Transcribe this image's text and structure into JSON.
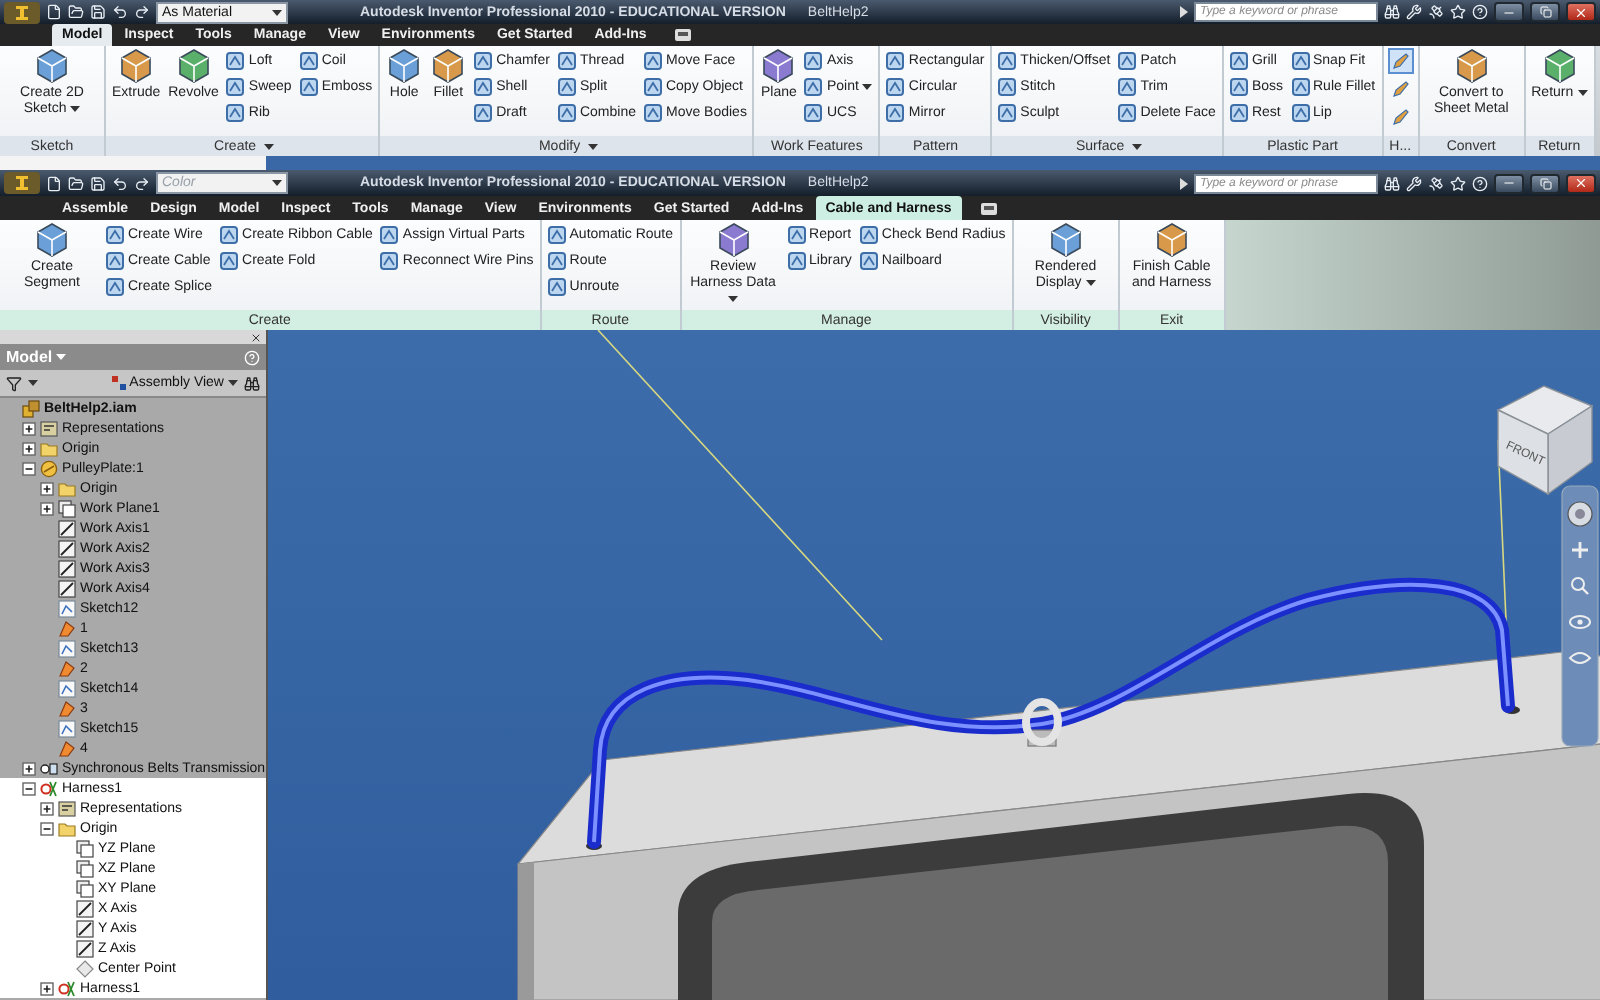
{
  "back_window": {
    "combo": {
      "value": "As Material",
      "disabled": false
    },
    "title": "Autodesk Inventor Professional 2010 - EDUCATIONAL VERSION",
    "document": "BeltHelp2",
    "search": {
      "placeholder": "Type a keyword or phrase"
    },
    "tabs": [
      {
        "label": "Model",
        "selected": true
      },
      {
        "label": "Inspect",
        "selected": false
      },
      {
        "label": "Tools",
        "selected": false
      },
      {
        "label": "Manage",
        "selected": false
      },
      {
        "label": "View",
        "selected": false
      },
      {
        "label": "Environments",
        "selected": false
      },
      {
        "label": "Get Started",
        "selected": false
      },
      {
        "label": "Add-Ins",
        "selected": false
      }
    ],
    "panels": [
      {
        "label": "Sketch",
        "columns": [
          [
            {
              "label": "Create 2D Sketch",
              "kind": "large",
              "menu": true
            }
          ]
        ]
      },
      {
        "label": "Create",
        "menu": true,
        "columns": [
          [
            {
              "label": "Extrude",
              "kind": "large"
            }
          ],
          [
            {
              "label": "Revolve",
              "kind": "large"
            }
          ],
          [
            {
              "label": "Loft",
              "kind": "small"
            },
            {
              "label": "Sweep",
              "kind": "small"
            },
            {
              "label": "Rib",
              "kind": "small"
            }
          ],
          [
            {
              "label": "Coil",
              "kind": "small"
            },
            {
              "label": "Emboss",
              "kind": "small"
            }
          ]
        ]
      },
      {
        "label": "Modify",
        "menu": true,
        "columns": [
          [
            {
              "label": "Hole",
              "kind": "large"
            }
          ],
          [
            {
              "label": "Fillet",
              "kind": "large"
            }
          ],
          [
            {
              "label": "Chamfer",
              "kind": "small"
            },
            {
              "label": "Shell",
              "kind": "small"
            },
            {
              "label": "Draft",
              "kind": "small"
            }
          ],
          [
            {
              "label": "Thread",
              "kind": "small"
            },
            {
              "label": "Split",
              "kind": "small"
            },
            {
              "label": "Combine",
              "kind": "small"
            }
          ],
          [
            {
              "label": "Move Face",
              "kind": "small"
            },
            {
              "label": "Copy Object",
              "kind": "small"
            },
            {
              "label": "Move Bodies",
              "kind": "small"
            }
          ]
        ]
      },
      {
        "label": "Work Features",
        "columns": [
          [
            {
              "label": "Plane",
              "kind": "large"
            }
          ],
          [
            {
              "label": "Axis",
              "kind": "small"
            },
            {
              "label": "Point",
              "kind": "small",
              "menu": true
            },
            {
              "label": "UCS",
              "kind": "small"
            }
          ]
        ]
      },
      {
        "label": "Pattern",
        "columns": [
          [
            {
              "label": "Rectangular",
              "kind": "small"
            },
            {
              "label": "Circular",
              "kind": "small"
            },
            {
              "label": "Mirror",
              "kind": "small"
            }
          ]
        ]
      },
      {
        "label": "Surface",
        "menu": true,
        "columns": [
          [
            {
              "label": "Thicken/Offset",
              "kind": "small"
            },
            {
              "label": "Stitch",
              "kind": "small"
            },
            {
              "label": "Sculpt",
              "kind": "small"
            }
          ],
          [
            {
              "label": "Patch",
              "kind": "small"
            },
            {
              "label": "Trim",
              "kind": "small"
            },
            {
              "label": "Delete Face",
              "kind": "small"
            }
          ]
        ]
      },
      {
        "label": "Plastic Part",
        "columns": [
          [
            {
              "label": "Grill",
              "kind": "small"
            },
            {
              "label": "Boss",
              "kind": "small"
            },
            {
              "label": "Rest",
              "kind": "small"
            }
          ],
          [
            {
              "label": "Snap Fit",
              "kind": "small"
            },
            {
              "label": "Rule Fillet",
              "kind": "small"
            },
            {
              "label": "Lip",
              "kind": "small"
            }
          ]
        ]
      },
      {
        "label": "H...",
        "columns": [
          [
            {
              "kind": "icon",
              "selected": true
            },
            {
              "kind": "icon",
              "selected": false
            },
            {
              "kind": "icon",
              "selected": false
            }
          ]
        ]
      },
      {
        "label": "Convert",
        "columns": [
          [
            {
              "label": "Convert to Sheet Metal",
              "kind": "large"
            }
          ]
        ]
      },
      {
        "label": "Return",
        "columns": [
          [
            {
              "label": "Return",
              "kind": "large",
              "menu": true
            }
          ]
        ]
      }
    ]
  },
  "front_window": {
    "combo": {
      "value": "Color",
      "disabled": true
    },
    "title": "Autodesk Inventor Professional 2010 - EDUCATIONAL VERSION",
    "document": "BeltHelp2",
    "search": {
      "placeholder": "Type a keyword or phrase"
    },
    "tabs": [
      {
        "label": "Assemble",
        "selected": false
      },
      {
        "label": "Design",
        "selected": false
      },
      {
        "label": "Model",
        "selected": false
      },
      {
        "label": "Inspect",
        "selected": false
      },
      {
        "label": "Tools",
        "selected": false
      },
      {
        "label": "Manage",
        "selected": false
      },
      {
        "label": "View",
        "selected": false
      },
      {
        "label": "Environments",
        "selected": false
      },
      {
        "label": "Get Started",
        "selected": false
      },
      {
        "label": "Add-Ins",
        "selected": false
      },
      {
        "label": "Cable and Harness",
        "selected": true
      }
    ],
    "panels": [
      {
        "label": "Create",
        "columns": [
          [
            {
              "label": "Create Segment",
              "kind": "large"
            }
          ],
          [
            {
              "label": "Create Wire",
              "kind": "small"
            },
            {
              "label": "Create Cable",
              "kind": "small"
            },
            {
              "label": "Create Splice",
              "kind": "small"
            }
          ],
          [
            {
              "label": "Create Ribbon Cable",
              "kind": "small"
            },
            {
              "label": "Create Fold",
              "kind": "small"
            }
          ],
          [
            {
              "label": "Assign Virtual Parts",
              "kind": "small"
            },
            {
              "label": "Reconnect Wire Pins",
              "kind": "small"
            }
          ]
        ]
      },
      {
        "label": "Route",
        "columns": [
          [
            {
              "label": "Automatic Route",
              "kind": "small"
            },
            {
              "label": "Route",
              "kind": "small"
            },
            {
              "label": "Unroute",
              "kind": "small"
            }
          ]
        ]
      },
      {
        "label": "Manage",
        "columns": [
          [
            {
              "label": "Review Harness Data",
              "kind": "large",
              "menu": true
            }
          ],
          [
            {
              "label": "Report",
              "kind": "small"
            },
            {
              "label": "Library",
              "kind": "small"
            }
          ],
          [
            {
              "label": "Check Bend Radius",
              "kind": "small"
            },
            {
              "label": "Nailboard",
              "kind": "small"
            }
          ]
        ]
      },
      {
        "label": "Visibility",
        "columns": [
          [
            {
              "label": "Rendered Display",
              "kind": "large",
              "menu": true
            }
          ]
        ]
      },
      {
        "label": "Exit",
        "columns": [
          [
            {
              "label": "Finish Cable and Harness",
              "kind": "large"
            }
          ]
        ]
      }
    ]
  },
  "browser": {
    "title": "Model",
    "view": "Assembly View",
    "tree": [
      {
        "label": "BeltHelp2.iam",
        "kind": "assembly",
        "children": [
          {
            "label": "Representations",
            "kind": "representations",
            "expanded": false
          },
          {
            "label": "Origin",
            "kind": "folder",
            "expanded": false
          },
          {
            "label": "PulleyPlate:1",
            "kind": "part",
            "expanded": true,
            "editing": false,
            "children": [
              {
                "label": "Origin",
                "kind": "folder",
                "expanded": false
              },
              {
                "label": "Work Plane1",
                "kind": "plane",
                "expanded": false
              },
              {
                "label": "Work Axis1",
                "kind": "axis"
              },
              {
                "label": "Work Axis2",
                "kind": "axis"
              },
              {
                "label": "Work Axis3",
                "kind": "axis"
              },
              {
                "label": "Work Axis4",
                "kind": "axis"
              },
              {
                "label": "Sketch12",
                "kind": "sketch"
              },
              {
                "label": "1",
                "kind": "feature"
              },
              {
                "label": "Sketch13",
                "kind": "sketch"
              },
              {
                "label": "2",
                "kind": "feature"
              },
              {
                "label": "Sketch14",
                "kind": "sketch"
              },
              {
                "label": "3",
                "kind": "feature"
              },
              {
                "label": "Sketch15",
                "kind": "sketch"
              },
              {
                "label": "4",
                "kind": "feature"
              }
            ]
          },
          {
            "label": "Synchronous Belts Transmission",
            "kind": "component",
            "expanded": false,
            "editing": false
          },
          {
            "label": "Harness1",
            "kind": "harness",
            "expanded": true,
            "editing": true,
            "children": [
              {
                "label": "Representations",
                "kind": "representations",
                "expanded": false
              },
              {
                "label": "Origin",
                "kind": "folder",
                "expanded": true,
                "children": [
                  {
                    "label": "YZ Plane",
                    "kind": "plane"
                  },
                  {
                    "label": "XZ Plane",
                    "kind": "plane"
                  },
                  {
                    "label": "XY Plane",
                    "kind": "plane"
                  },
                  {
                    "label": "X Axis",
                    "kind": "axis"
                  },
                  {
                    "label": "Y Axis",
                    "kind": "axis"
                  },
                  {
                    "label": "Z Axis",
                    "kind": "axis"
                  },
                  {
                    "label": "Center Point",
                    "kind": "point"
                  }
                ]
              },
              {
                "label": "Harness1",
                "kind": "harness",
                "expanded": false
              }
            ]
          }
        ]
      }
    ]
  },
  "viewport": {
    "view_cube": {
      "face_label": "FRONT"
    }
  }
}
